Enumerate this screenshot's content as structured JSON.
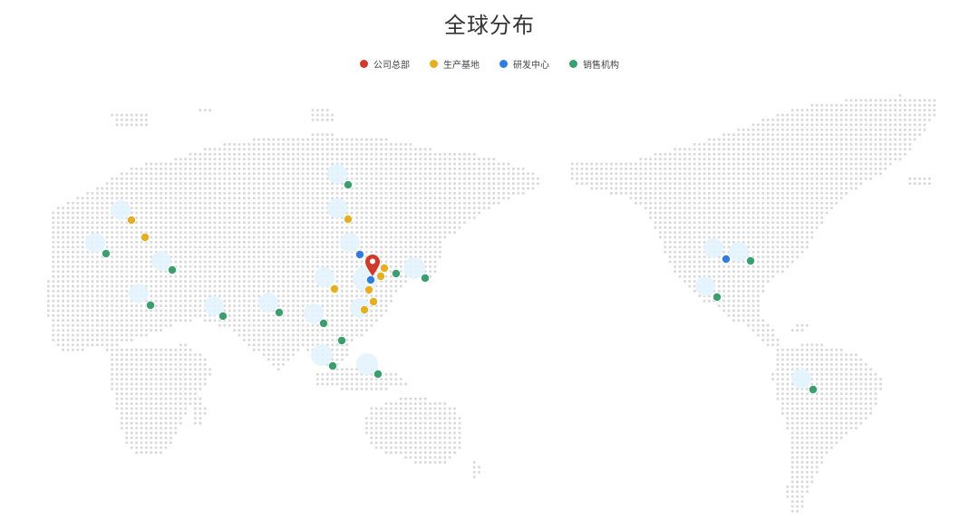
{
  "title": "全球分布",
  "legend": [
    {
      "label": "公司总部",
      "color": "#D03A2B"
    },
    {
      "label": "生产基地",
      "color": "#E6AE23"
    },
    {
      "label": "研发中心",
      "color": "#2F7DE1"
    },
    {
      "label": "销售机构",
      "color": "#3A9E6E"
    }
  ],
  "map": {
    "dot_color": "#D9D9D9",
    "halo_color": "#E3F4FD",
    "headquarters_icon": "map-pin-icon"
  }
}
